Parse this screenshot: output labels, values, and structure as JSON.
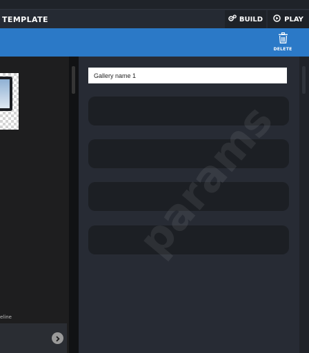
{
  "header": {
    "title": "TEMPLATE",
    "build_label": "BUILD",
    "play_label": "PLAY"
  },
  "toolbar": {
    "delete_label": "DELETE"
  },
  "left_panel": {
    "timeline_label": "eline"
  },
  "form": {
    "gallery_name_value": "Gallery name 1"
  },
  "watermark": {
    "text": "params"
  },
  "colors": {
    "toolbar_blue": "#2b79c7",
    "topbar": "#252a33",
    "panel_bg": "#272b34",
    "field_bg": "#1c1f24"
  },
  "icons": {
    "build": "gears-icon",
    "play": "play-circle-icon",
    "delete": "trash-icon",
    "next": "chevron-right-icon"
  }
}
